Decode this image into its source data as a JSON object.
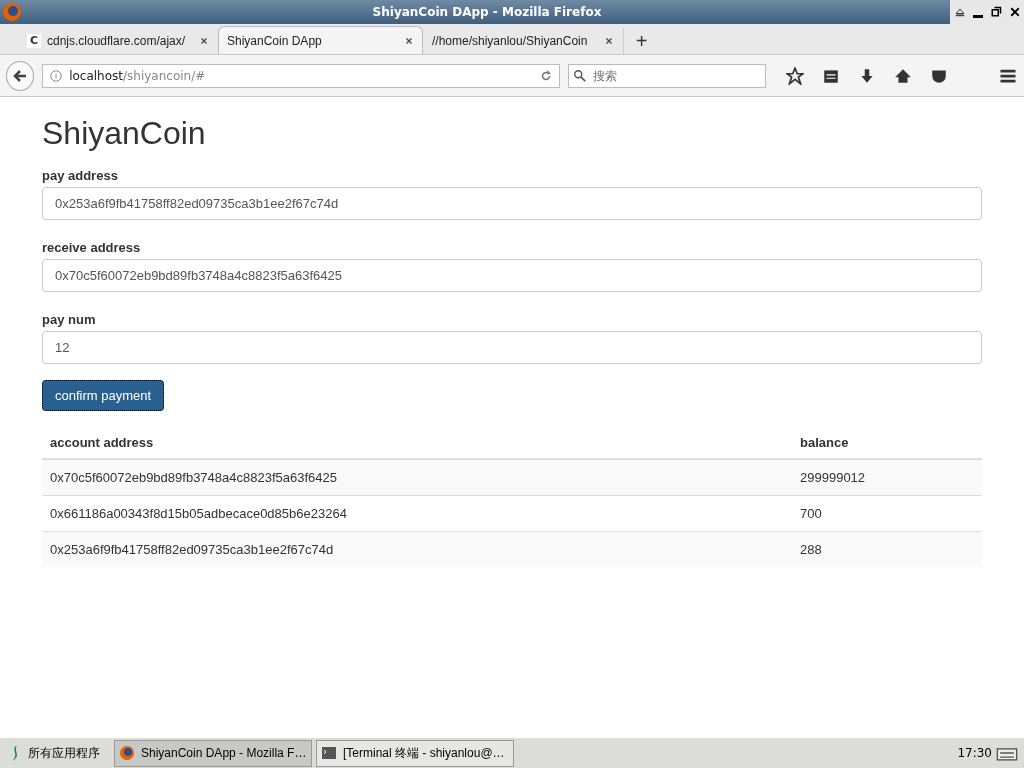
{
  "window": {
    "title": "ShiyanCoin DApp - Mozilla Firefox"
  },
  "tabs": [
    {
      "label": "cdnjs.cloudflare.com/ajax/",
      "favicon": "C",
      "selected": false
    },
    {
      "label": "ShiyanCoin DApp",
      "selected": true
    },
    {
      "label": "//home/shiyanlou/ShiyanCoin",
      "selected": false
    }
  ],
  "new_tab": "+",
  "address_bar": {
    "host": "localhost",
    "path": "/shiyancoin/#"
  },
  "search": {
    "placeholder": "搜索"
  },
  "page": {
    "heading": "ShiyanCoin",
    "fields": [
      {
        "label": "pay address",
        "value": "0x253a6f9fb41758ff82ed09735ca3b1ee2f67c74d"
      },
      {
        "label": "receive address",
        "value": "0x70c5f60072eb9bd89fb3748a4c8823f5a63f6425"
      },
      {
        "label": "pay num",
        "value": "12"
      }
    ],
    "button": "confirm payment",
    "table": {
      "columns": [
        "account address",
        "balance"
      ],
      "rows": [
        [
          "0x70c5f60072eb9bd89fb3748a4c8823f5a63f6425",
          "299999012"
        ],
        [
          "0x661186a00343f8d15b05adbecace0d85b6e23264",
          "700"
        ],
        [
          "0x253a6f9fb41758ff82ed09735ca3b1ee2f67c74d",
          "288"
        ]
      ]
    }
  },
  "taskbar": {
    "start": "所有应用程序",
    "tasks": [
      {
        "label": "ShiyanCoin DApp - Mozilla F…",
        "kind": "browser",
        "selected": true
      },
      {
        "label": "[Terminal 终端 - shiyanlou@…",
        "kind": "terminal",
        "selected": false
      }
    ],
    "clock": "17:30"
  }
}
